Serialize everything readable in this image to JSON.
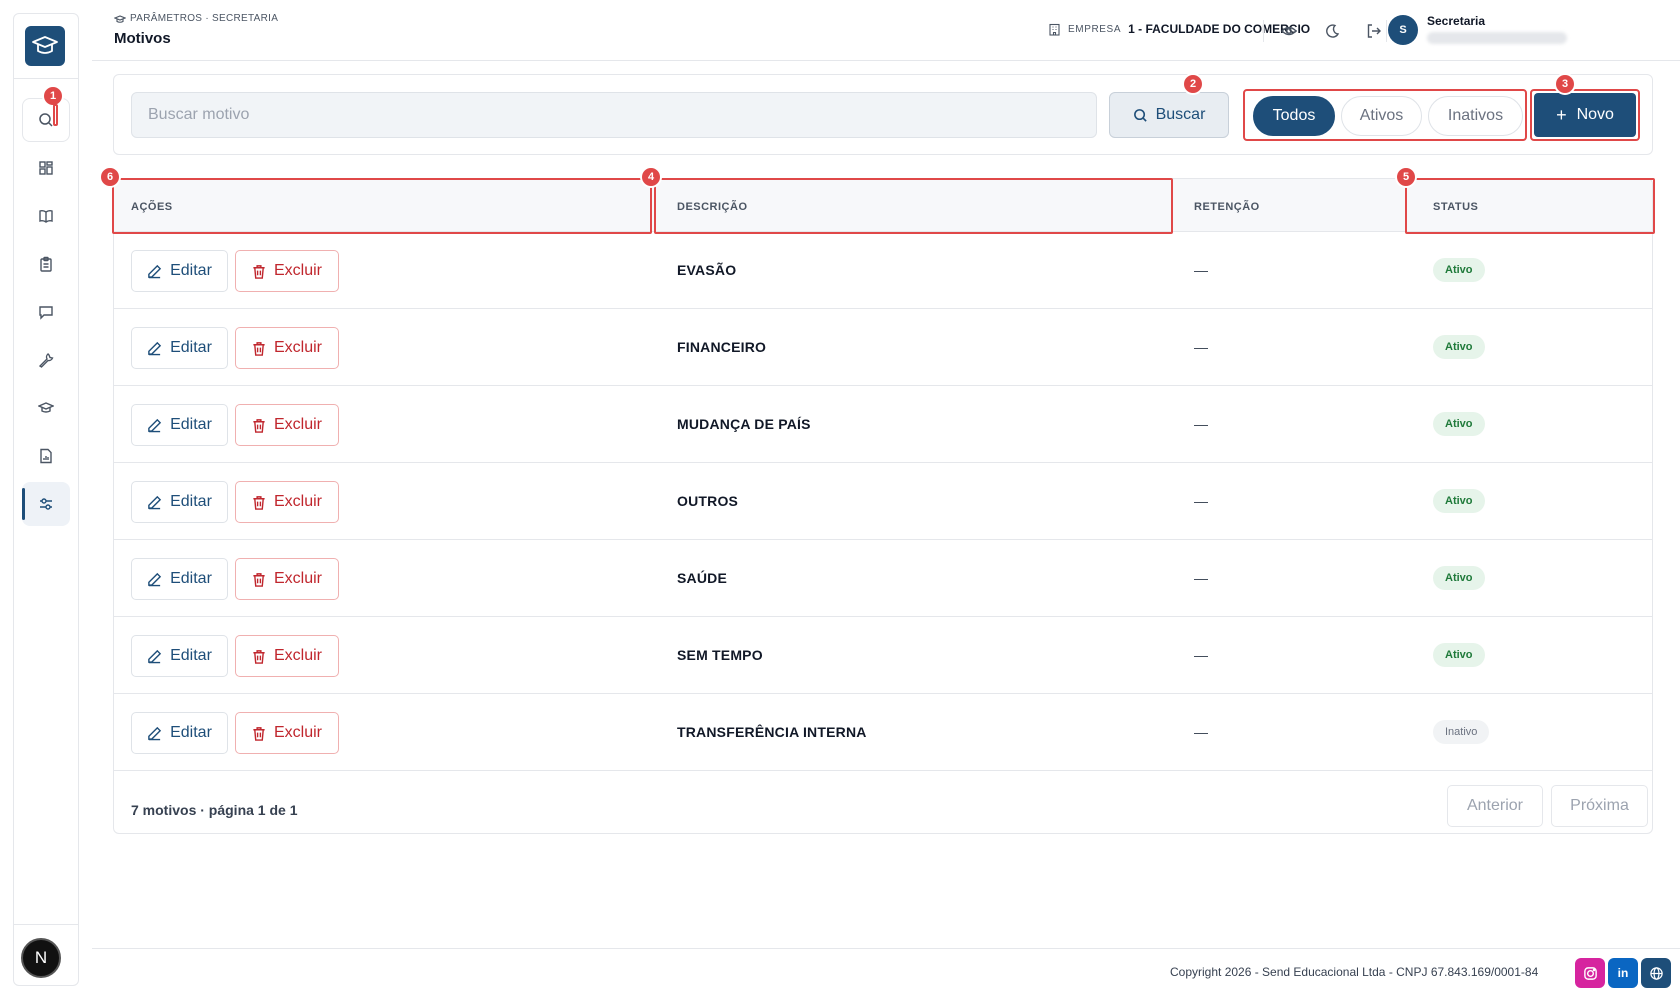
{
  "header": {
    "breadcrumb": "PARÂMETROS · SECRETARIA",
    "title": "Motivos",
    "company_label": "EMPRESA",
    "company_value": "1 - FACULDADE DO COMERCIO",
    "user_initial": "S",
    "user_name": "Secretaria"
  },
  "sidebar": {
    "bottom_avatar": "N",
    "items": [
      {
        "icon": "search-icon",
        "badge": "1"
      },
      {
        "icon": "grid-icon"
      },
      {
        "icon": "book-icon"
      },
      {
        "icon": "clipboard-icon"
      },
      {
        "icon": "chat-icon"
      },
      {
        "icon": "wrench-icon"
      },
      {
        "icon": "graduation-cap-icon"
      },
      {
        "icon": "document-icon"
      },
      {
        "icon": "sliders-icon",
        "active": true
      }
    ]
  },
  "toolbar": {
    "search_placeholder": "Buscar motivo",
    "search_button": "Buscar",
    "filters": [
      "Todos",
      "Ativos",
      "Inativos"
    ],
    "active_filter": "Todos",
    "new_button": "Novo"
  },
  "table": {
    "columns": [
      "AÇÕES",
      "DESCRIÇÃO",
      "RETENÇÃO",
      "STATUS"
    ],
    "edit_label": "Editar",
    "delete_label": "Excluir",
    "rows": [
      {
        "descricao": "EVASÃO",
        "retencao": "—",
        "status": "Ativo"
      },
      {
        "descricao": "FINANCEIRO",
        "retencao": "—",
        "status": "Ativo"
      },
      {
        "descricao": "MUDANÇA DE PAÍS",
        "retencao": "—",
        "status": "Ativo"
      },
      {
        "descricao": "OUTROS",
        "retencao": "—",
        "status": "Ativo"
      },
      {
        "descricao": "SAÚDE",
        "retencao": "—",
        "status": "Ativo"
      },
      {
        "descricao": "SEM TEMPO",
        "retencao": "—",
        "status": "Ativo"
      },
      {
        "descricao": "TRANSFERÊNCIA INTERNA",
        "retencao": "—",
        "status": "Inativo"
      }
    ],
    "summary": "7 motivos · página 1 de 1",
    "prev_label": "Anterior",
    "next_label": "Próxima"
  },
  "markers": [
    "1",
    "2",
    "3",
    "4",
    "5",
    "6"
  ],
  "footer": {
    "copyright": "Copyright 2026 - Send Educacional Ltda - CNPJ 67.843.169/0001-84",
    "social_linkedin": "in"
  },
  "colors": {
    "primary": "#1e4e79",
    "danger": "#c0262d",
    "highlight": "#e04848",
    "success_bg": "#e6f4ea",
    "success_text": "#1f7a3a"
  }
}
